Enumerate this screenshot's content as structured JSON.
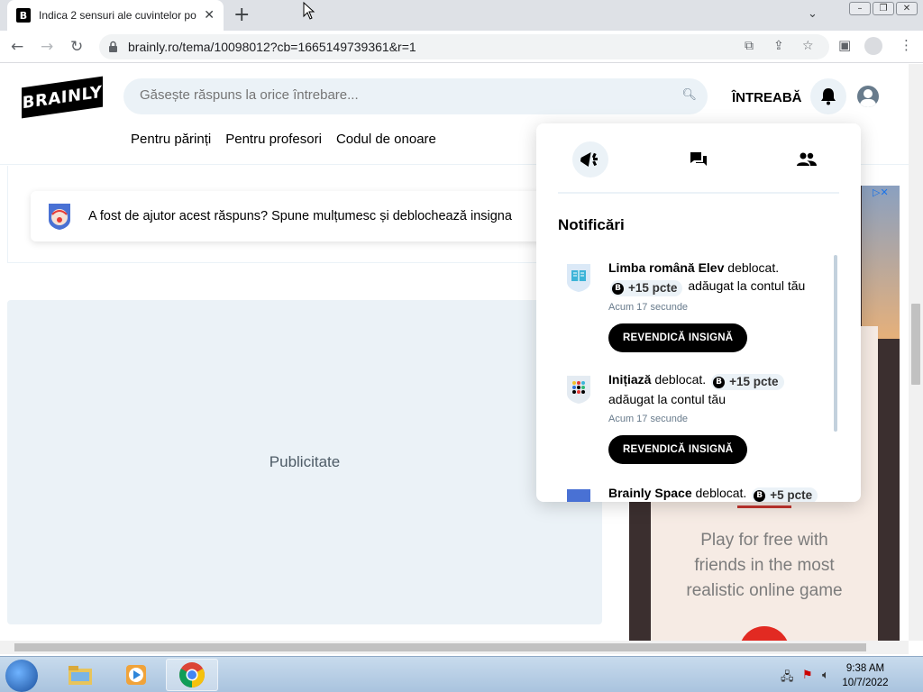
{
  "browser": {
    "tab_title": "Indica 2 sensuri ale cuvintelor po",
    "favicon": "B",
    "close_glyph": "✕",
    "newtab_glyph": "+",
    "url": "brainly.ro/tema/10098012?cb=1665149739361&r=1"
  },
  "header": {
    "logo": "BRAINLY",
    "search_placeholder": "Găsește răspuns la orice întrebare...",
    "ask_label": "ÎNTREABĂ",
    "nav": [
      "Pentru părinți",
      "Pentru profesori",
      "Codul de onoare"
    ]
  },
  "help_prompt": "A fost de ajutor acest răspuns? Spune mulțumesc și deblochează insigna",
  "ad_placeholder": "Publicitate",
  "side_ad": {
    "text_lines": [
      "Play for free with",
      "friends in the most",
      "realistic online game"
    ]
  },
  "notifications": {
    "title": "Notificări",
    "items": [
      {
        "name": "Limba română Elev",
        "unlocked": "deblocat.",
        "points": "+15 pcte",
        "suffix": "adăugat la contul tău",
        "time": "Acum 17 secunde",
        "button": "REVENDICĂ INSIGNĂ"
      },
      {
        "name": "Inițiază",
        "unlocked": "deblocat.",
        "points": "+15 pcte",
        "suffix": "adăugat la contul tău",
        "time": "Acum 17 secunde",
        "button": "REVENDICĂ INSIGNĂ"
      },
      {
        "name": "Brainly Space",
        "unlocked": "deblocat.",
        "points": "+5 pcte"
      }
    ]
  },
  "taskbar": {
    "time": "9:38 AM",
    "date": "10/7/2022"
  },
  "colors": {
    "accent_bg": "#ebf2f7",
    "brand": "#000000",
    "ad_red": "#e22a22"
  }
}
